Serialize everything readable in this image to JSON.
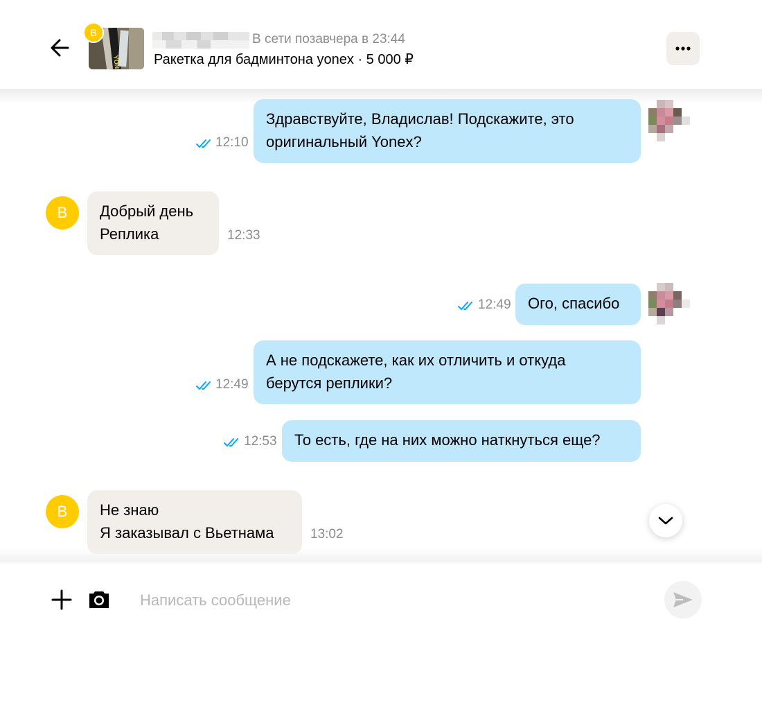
{
  "header": {
    "back_icon": "arrow-left-icon",
    "seller_badge": "В",
    "status": "В сети позавчера в 23:44",
    "item_title": "Ракетка для бадминтона yonex · 5 000 ₽",
    "menu_icon": "more-horizontal-icon"
  },
  "messages": [
    {
      "direction": "out",
      "lines": [
        "Здравствуйте, Владислав! Подскажите, это",
        "оригинальный Yonex?"
      ],
      "time": "12:10",
      "read": true
    },
    {
      "direction": "in",
      "avatar": "В",
      "lines": [
        "Добрый день",
        "Реплика"
      ],
      "time": "12:33"
    },
    {
      "direction": "out",
      "lines": [
        "Ого, спасибо"
      ],
      "time": "12:49",
      "read": true
    },
    {
      "direction": "out",
      "lines": [
        "А не подскажете, как их отличить и откуда",
        "берутся реплики?"
      ],
      "time": "12:49",
      "read": true
    },
    {
      "direction": "out",
      "lines": [
        "То есть, где на них можно наткнуться еще?"
      ],
      "time": "12:53",
      "read": true
    },
    {
      "direction": "in",
      "avatar": "В",
      "lines": [
        "Не знаю",
        "Я заказывал с Вьетнама"
      ],
      "time": "13:02"
    }
  ],
  "composer": {
    "placeholder": "Написать сообщение",
    "value": "",
    "attach_icon": "plus-icon",
    "camera_icon": "camera-icon",
    "send_icon": "send-icon"
  },
  "colors": {
    "outgoing_bubble": "#bfe8fd",
    "incoming_bubble": "#f2efea",
    "avatar_yellow": "#ffcc00",
    "read_ticks": "#00aaff",
    "muted_text": "#8c8c8c"
  }
}
